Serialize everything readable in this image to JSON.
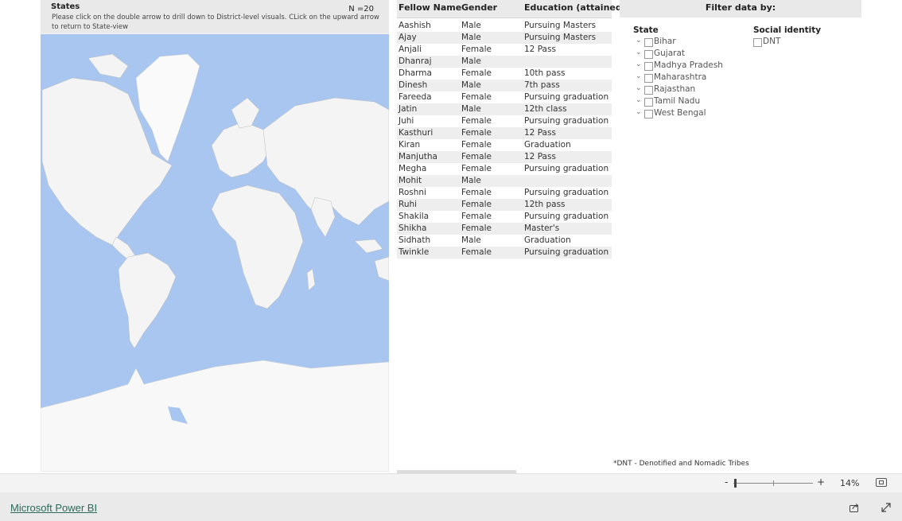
{
  "map": {
    "title": "States",
    "count": "N =20",
    "instructions": "Please click on the double arrow to drill down to District-level visuals. CLick on the upward arrow to return to State-view"
  },
  "table": {
    "headers": [
      "Fellow Name",
      "Gender",
      "Education (attained)"
    ],
    "rows": [
      [
        "Aashish",
        "Male",
        "Pursuing Masters"
      ],
      [
        "Ajay",
        "Male",
        "Pursuing Masters"
      ],
      [
        "Anjali",
        "Female",
        "12 Pass"
      ],
      [
        "Dhanraj",
        "Male",
        ""
      ],
      [
        "Dharma",
        "Female",
        "10th pass"
      ],
      [
        "Dinesh",
        "Male",
        "7th pass"
      ],
      [
        "Fareeda",
        "Female",
        "Pursuing graduation"
      ],
      [
        "Jatin",
        "Male",
        "12th class"
      ],
      [
        "Juhi",
        "Female",
        "Pursuing graduation"
      ],
      [
        "Kasthuri",
        "Female",
        "12 Pass"
      ],
      [
        "Kiran",
        "Female",
        "Graduation"
      ],
      [
        "Manjutha",
        "Female",
        "12 Pass"
      ],
      [
        "Megha",
        "Female",
        "Pursuing graduation"
      ],
      [
        "Mohit",
        "Male",
        ""
      ],
      [
        "Roshni",
        "Female",
        "Pursuing graduation"
      ],
      [
        "Ruhi",
        "Female",
        "12th pass"
      ],
      [
        "Shakila",
        "Female",
        "Pursuing graduation"
      ],
      [
        "Shikha",
        "Female",
        "Master's"
      ],
      [
        "Sidhath",
        "Male",
        "Graduation"
      ],
      [
        "Twinkle",
        "Female",
        "Pursuing graduation"
      ]
    ]
  },
  "filter": {
    "title": "Filter data by:",
    "state_title": "State",
    "states": [
      "Bihar",
      "Gujarat",
      "Madhya Pradesh",
      "Maharashtra",
      "Rajasthan",
      "Tamil Nadu",
      "West Bengal"
    ],
    "social_title": "Social identity",
    "social": [
      "DNT"
    ]
  },
  "footnote": "*DNT - Denotified and Nomadic Tribes",
  "zoom": {
    "minus": "-",
    "plus": "+",
    "percent": "14%"
  },
  "brand": "Microsoft Power BI",
  "icons": {
    "expand_arrows": "chevron-down-icon",
    "share": "share-icon",
    "fullscreen": "expand-icon",
    "fit": "fit-page-icon"
  },
  "colors": {
    "ocean": "#a8c6f0",
    "land": "#f4f4f4",
    "header": "#e9e9e9",
    "brand": "#2b6a5a"
  }
}
